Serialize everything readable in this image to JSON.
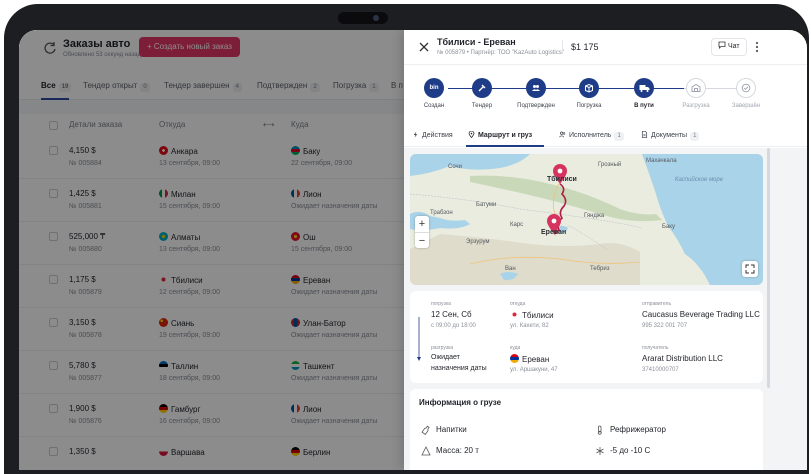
{
  "list": {
    "title": "Заказы авто",
    "subtitle": "Обновлено 53 секунд назад",
    "create_button": "+ Создать новый заказ",
    "tabs": [
      {
        "label": "Все",
        "count": "19"
      },
      {
        "label": "Тендер открыт",
        "count": "0"
      },
      {
        "label": "Тендер завершен",
        "count": "4"
      },
      {
        "label": "Подтвержден",
        "count": "2"
      },
      {
        "label": "Погрузка",
        "count": "1"
      },
      {
        "label": "В п",
        "count": ""
      }
    ],
    "columns": {
      "details": "Детали заказа",
      "from": "Откуда",
      "arrow": "⟷",
      "to": "Куда"
    },
    "rows": [
      {
        "price": "4,150 $",
        "order": "№ 005884",
        "from": "Анкара",
        "from_date": "13 сентября, 09:00",
        "to": "Баку",
        "to_date": "22 сентября, 09:00"
      },
      {
        "price": "1,425 $",
        "order": "№ 005881",
        "from": "Милан",
        "from_date": "15 сентября, 09:00",
        "to": "Лион",
        "to_date": "Ожидает назначения даты"
      },
      {
        "price": "525,000 ₸",
        "order": "№ 005880",
        "from": "Алматы",
        "from_date": "13 сентября, 09:00",
        "to": "Ош",
        "to_date": "15 сентября, 09:00"
      },
      {
        "price": "1,175 $",
        "order": "№ 005879",
        "from": "Тбилиси",
        "from_date": "12 сентября, 09:00",
        "to": "Ереван",
        "to_date": "Ожидает назначения даты"
      },
      {
        "price": "3,150 $",
        "order": "№ 005878",
        "from": "Сиань",
        "from_date": "19 сентября, 09:00",
        "to": "Улан-Батор",
        "to_date": "Ожидает назначения даты"
      },
      {
        "price": "5,780 $",
        "order": "№ 005877",
        "from": "Таллин",
        "from_date": "18 сентября, 09:00",
        "to": "Ташкент",
        "to_date": "Ожидает назначения даты"
      },
      {
        "price": "1,900 $",
        "order": "№ 005876",
        "from": "Гамбург",
        "from_date": "16 сентября, 09:00",
        "to": "Лион",
        "to_date": "Ожидает назначения даты"
      },
      {
        "price": "1,350 $",
        "order": "",
        "from": "Варшава",
        "from_date": "",
        "to": "Берлин",
        "to_date": ""
      }
    ]
  },
  "panel": {
    "route": "Тбилиси - Ереван",
    "subtitle": "№ 005879 • Партнёр: ТОО \"KazAuto Logistics\"",
    "price": "$1 175",
    "chat": "Чат",
    "steps": [
      {
        "label": "Создан",
        "state": "done"
      },
      {
        "label": "Тендер",
        "state": "done"
      },
      {
        "label": "Подтвержден",
        "state": "done"
      },
      {
        "label": "Погрузка",
        "state": "done"
      },
      {
        "label": "В пути",
        "state": "current"
      },
      {
        "label": "Разгрузка",
        "state": "pending"
      },
      {
        "label": "Завершён",
        "state": "pending"
      }
    ],
    "step_logo": "bin",
    "tabs": [
      {
        "label": "Действия",
        "count": ""
      },
      {
        "label": "Маршрут и груз",
        "count": ""
      },
      {
        "label": "Исполнитель",
        "count": "1"
      },
      {
        "label": "Документы",
        "count": "1"
      }
    ],
    "map": {
      "labels": {
        "tbilisi": "Тбилиси",
        "yerevan": "Ереван",
        "caspian": "Каспийское море",
        "ganja": "Гянджа",
        "baku": "Баку",
        "kars": "Карс",
        "erzurum": "Эрзурум",
        "van": "Ван",
        "tabriz": "Тебриз",
        "batumi": "Батуми",
        "sochi": "Сочи",
        "trabzon": "Трабзон",
        "grozny": "Грозный",
        "makhachkala": "Махачкала"
      },
      "zoom_in": "+",
      "zoom_out": "−"
    },
    "details": {
      "loading_caption": "погрузка",
      "loading_date": "12 Сен, Сб",
      "loading_time": "с 09:00 до 18:00",
      "from_caption": "откуда",
      "from_city": "Тбилиси",
      "from_address": "ул. Кахети, 82",
      "sender_caption": "отправитель",
      "sender_name": "Caucasus Beverage Trading LLC",
      "sender_phone": "995 322 001 707",
      "unloading_caption": "разгрузка",
      "unloading_status_1": "Ожидает",
      "unloading_status_2": "назначения даты",
      "to_caption": "куда",
      "to_city": "Ереван",
      "to_address": "ул. Аршакуни, 47",
      "receiver_caption": "получатель",
      "receiver_name": "Ararat Distribution LLC",
      "receiver_phone": "37410000707"
    },
    "cargo": {
      "title": "Информация о грузе",
      "type": "Напитки",
      "vehicle": "Рефрижератор",
      "mass": "Масса:  20 т",
      "temperature": "-5 до -10 С"
    }
  },
  "colors": {
    "accent_red": "#e33867",
    "primary_blue": "#1f3c88",
    "route": "#b01e45"
  }
}
